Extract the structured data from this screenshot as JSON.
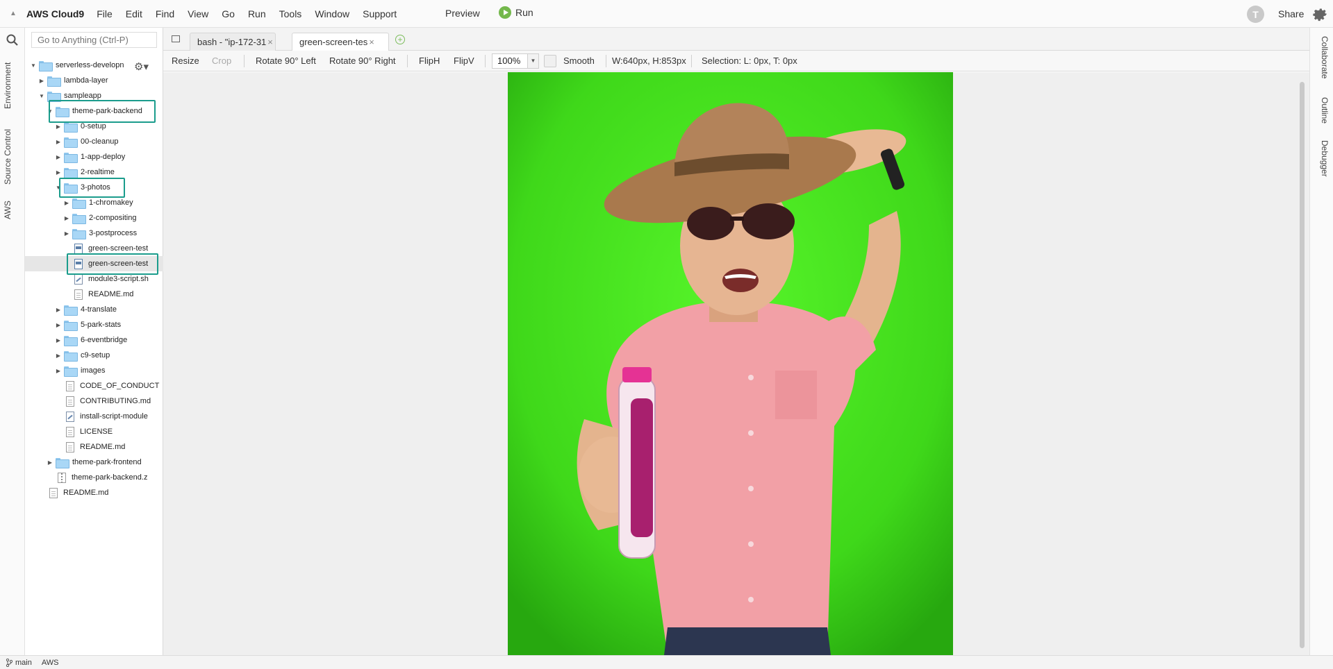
{
  "menubar": {
    "brand": "AWS Cloud9",
    "items": [
      "File",
      "Edit",
      "Find",
      "View",
      "Go",
      "Run",
      "Tools",
      "Window",
      "Support"
    ],
    "preview": "Preview",
    "run": "Run",
    "avatar_initial": "T",
    "share": "Share"
  },
  "left_tabs": [
    "Environment",
    "Source Control",
    "AWS"
  ],
  "right_tabs": [
    "Collaborate",
    "Outline",
    "Debugger"
  ],
  "search": {
    "placeholder": "Go to Anything (Ctrl-P)"
  },
  "tree": {
    "rows": [
      {
        "label": "serverless-developn",
        "depth": 0,
        "type": "folder",
        "expanded": true
      },
      {
        "label": "lambda-layer",
        "depth": 1,
        "type": "folder",
        "expanded": false
      },
      {
        "label": "sampleapp",
        "depth": 1,
        "type": "folder",
        "expanded": true
      },
      {
        "label": "theme-park-backend",
        "depth": 2,
        "type": "folder",
        "expanded": true
      },
      {
        "label": "0-setup",
        "depth": 3,
        "type": "folder",
        "expanded": false
      },
      {
        "label": "00-cleanup",
        "depth": 3,
        "type": "folder",
        "expanded": false
      },
      {
        "label": "1-app-deploy",
        "depth": 3,
        "type": "folder",
        "expanded": false
      },
      {
        "label": "2-realtime",
        "depth": 3,
        "type": "folder",
        "expanded": false
      },
      {
        "label": "3-photos",
        "depth": 3,
        "type": "folder",
        "expanded": true
      },
      {
        "label": "1-chromakey",
        "depth": 4,
        "type": "folder",
        "expanded": false
      },
      {
        "label": "2-compositing",
        "depth": 4,
        "type": "folder",
        "expanded": false
      },
      {
        "label": "3-postprocess",
        "depth": 4,
        "type": "folder",
        "expanded": false
      },
      {
        "label": "green-screen-test",
        "depth": 4,
        "type": "img"
      },
      {
        "label": "green-screen-test",
        "depth": 4,
        "type": "img",
        "selected": true
      },
      {
        "label": "module3-script.sh",
        "depth": 4,
        "type": "script"
      },
      {
        "label": "README.md",
        "depth": 4,
        "type": "file"
      },
      {
        "label": "4-translate",
        "depth": 3,
        "type": "folder",
        "expanded": false
      },
      {
        "label": "5-park-stats",
        "depth": 3,
        "type": "folder",
        "expanded": false
      },
      {
        "label": "6-eventbridge",
        "depth": 3,
        "type": "folder",
        "expanded": false
      },
      {
        "label": "c9-setup",
        "depth": 3,
        "type": "folder",
        "expanded": false
      },
      {
        "label": "images",
        "depth": 3,
        "type": "folder",
        "expanded": false
      },
      {
        "label": "CODE_OF_CONDUCT",
        "depth": 3,
        "type": "file"
      },
      {
        "label": "CONTRIBUTING.md",
        "depth": 3,
        "type": "file"
      },
      {
        "label": "install-script-module",
        "depth": 3,
        "type": "script"
      },
      {
        "label": "LICENSE",
        "depth": 3,
        "type": "file"
      },
      {
        "label": "README.md",
        "depth": 3,
        "type": "file"
      },
      {
        "label": "theme-park-frontend",
        "depth": 2,
        "type": "folder",
        "expanded": false
      },
      {
        "label": "theme-park-backend.z",
        "depth": 2,
        "type": "zip"
      },
      {
        "label": "README.md",
        "depth": 1,
        "type": "file"
      }
    ]
  },
  "tabs": [
    {
      "label": "bash - \"ip-172-31",
      "active": false
    },
    {
      "label": "green-screen-tes",
      "active": true
    }
  ],
  "toolbar": {
    "resize": "Resize",
    "crop": "Crop",
    "rotate_left": "Rotate 90° Left",
    "rotate_right": "Rotate 90° Right",
    "fliph": "FlipH",
    "flipv": "FlipV",
    "zoom": "100%",
    "smooth": "Smooth",
    "dimensions": "W:640px, H:853px",
    "selection": "Selection:  L: 0px, T: 0px"
  },
  "status": {
    "branch": "main",
    "region": "AWS"
  },
  "colors": {
    "highlight": "#1a9c8c",
    "green_screen": "#44e01c",
    "run": "#74b84c"
  }
}
